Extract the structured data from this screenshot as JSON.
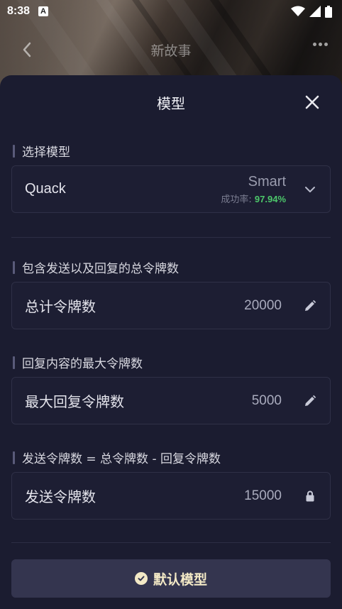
{
  "status_bar": {
    "time": "8:38",
    "badge": "A"
  },
  "app_header": {
    "title": "新故事"
  },
  "sheet": {
    "title": "模型",
    "model_section": {
      "label": "选择模型",
      "model_name": "Quack",
      "tier": "Smart",
      "success_rate_label": "成功率:",
      "success_rate_value": "97.94%"
    },
    "total_section": {
      "label": "包含发送以及回复的总令牌数",
      "name": "总计令牌数",
      "value": "20000"
    },
    "reply_section": {
      "label": "回复内容的最大令牌数",
      "name": "最大回复令牌数",
      "value": "5000"
    },
    "send_section": {
      "label": "发送令牌数 = 总令牌数 - 回复令牌数",
      "name": "发送令牌数",
      "value": "15000"
    },
    "default_button": "默认模型"
  },
  "icons": {
    "back": "chevron-left-icon",
    "more": "more-icon",
    "close": "close-icon",
    "chevron": "chevron-down-icon",
    "edit": "pencil-icon",
    "lock": "lock-icon",
    "check": "check-circle-icon"
  },
  "colors": {
    "sheet_bg": "#1b1c30",
    "success": "#4cc76a",
    "button_bg": "#34354f",
    "button_text": "#f3e9c6"
  }
}
